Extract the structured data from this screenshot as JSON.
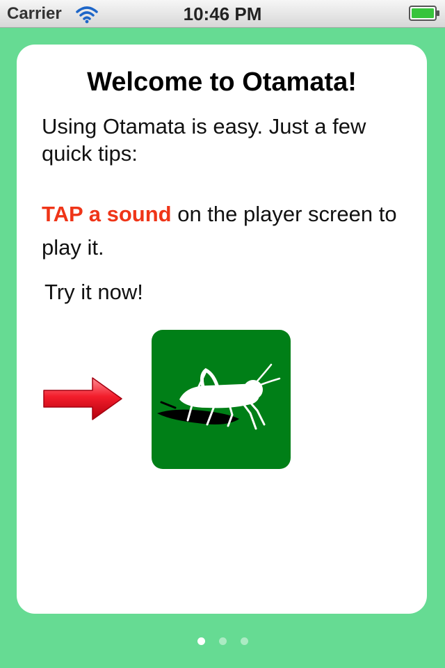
{
  "status_bar": {
    "carrier": "Carrier",
    "wifi_icon": "wifi-icon",
    "time": "10:46 PM",
    "battery_icon": "battery-icon"
  },
  "card": {
    "title": "Welcome to Otamata!",
    "intro": "Using Otamata is easy.  Just a few quick tips:",
    "tip": {
      "highlight": "TAP a sound",
      "rest": " on the player screen to play it."
    },
    "try_now": "Try it now!",
    "arrow_icon": "red-arrow-right-icon",
    "sound_button": {
      "icon": "grasshopper-icon",
      "background": "#007f17"
    }
  },
  "page_control": {
    "count": 3,
    "active_index": 0
  },
  "colors": {
    "background": "#66db93",
    "highlight": "#ef3518",
    "battery": "#37c43c"
  }
}
